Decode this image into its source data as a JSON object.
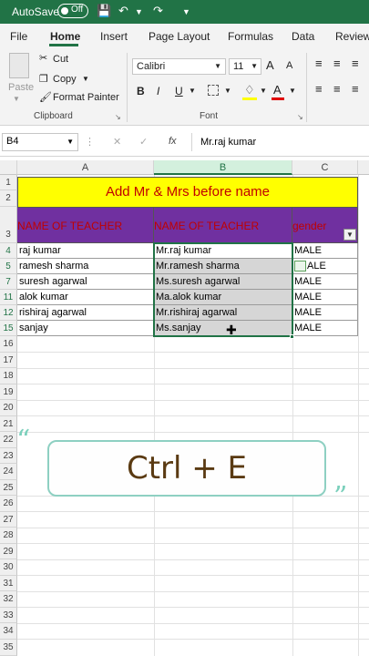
{
  "titlebar": {
    "autosave_label": "AutoSave",
    "toggle_state": "Off"
  },
  "menu": {
    "tabs": [
      "File",
      "Home",
      "Insert",
      "Page Layout",
      "Formulas",
      "Data",
      "Review"
    ],
    "active": "Home"
  },
  "ribbon": {
    "paste_label": "Paste",
    "cut_label": "Cut",
    "copy_label": "Copy",
    "format_painter_label": "Format Painter",
    "clipboard_group": "Clipboard",
    "font_name": "Calibri",
    "font_size": "11",
    "font_group": "Font",
    "bold": "B",
    "italic": "I",
    "underline": "U",
    "grow_font": "A",
    "shrink_font": "A",
    "font_color": "A"
  },
  "formula_bar": {
    "name_box": "B4",
    "fx": "fx",
    "formula": "Mr.raj kumar"
  },
  "columns": [
    "A",
    "B",
    "C"
  ],
  "rows": [
    "1",
    "2",
    "3",
    "4",
    "5",
    "7",
    "11",
    "12",
    "15",
    "16",
    "17",
    "18",
    "19",
    "20",
    "21",
    "22",
    "23",
    "24",
    "25",
    "26",
    "27",
    "28",
    "29",
    "30",
    "31",
    "32",
    "33",
    "34",
    "35"
  ],
  "sheet": {
    "title": "Add Mr & Mrs before name",
    "headers": [
      "NAME OF TEACHER",
      "NAME OF TEACHER",
      "gender"
    ],
    "data": [
      [
        "raj kumar",
        "Mr.raj kumar",
        "MALE"
      ],
      [
        "ramesh sharma",
        "Mr.ramesh sharma",
        "ALE"
      ],
      [
        "suresh agarwal",
        "Ms.suresh agarwal",
        "MALE"
      ],
      [
        "alok kumar",
        "Ma.alok kumar",
        "MALE"
      ],
      [
        "rishiraj agarwal",
        "Mr.rishiraj agarwal",
        "MALE"
      ],
      [
        "sanjay",
        "Ms.sanjay",
        "MALE"
      ]
    ]
  },
  "overlay": {
    "shortcut": "Ctrl + E",
    "open_quote": "“",
    "close_quote": "”"
  },
  "colors": {
    "excel_green": "#217346",
    "title_bg": "#ffff00",
    "header_bg": "#7030a0",
    "header_text": "#c00000",
    "accent": "#8ed0c2"
  }
}
